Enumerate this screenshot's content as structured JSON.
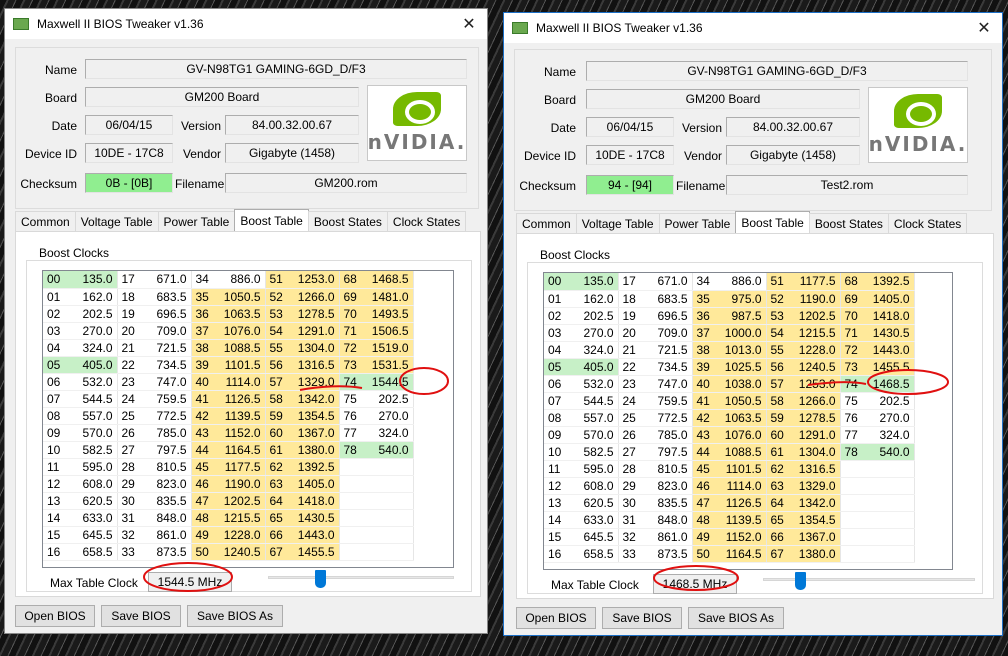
{
  "windows": [
    {
      "title": "Maxwell II BIOS Tweaker v1.36",
      "close_glyph": "✕",
      "info": {
        "name_label": "Name",
        "name_value": "GV-N98TG1 GAMING-6GD_D/F3",
        "board_label": "Board",
        "board_value": "GM200 Board",
        "date_label": "Date",
        "date_value": "06/04/15",
        "version_label": "Version",
        "version_value": "84.00.32.00.67",
        "device_label": "Device ID",
        "device_value": "10DE - 17C8",
        "vendor_label": "Vendor",
        "vendor_value": "Gigabyte (1458)",
        "checksum_label": "Checksum",
        "checksum_value": "0B - [0B]",
        "filename_label": "Filename",
        "filename_value": "GM200.rom"
      },
      "logo_text": "nVIDIA.",
      "tabs": [
        "Common",
        "Voltage Table",
        "Power Table",
        "Boost Table",
        "Boost States",
        "Clock States"
      ],
      "active_tab": 3,
      "group_title": "Boost Clocks",
      "rows": [
        [
          "00",
          "135.0",
          "17",
          "671.0",
          "34",
          "886.0",
          "51",
          "1253.0",
          "68",
          "1468.5"
        ],
        [
          "01",
          "162.0",
          "18",
          "683.5",
          "35",
          "1050.5",
          "52",
          "1266.0",
          "69",
          "1481.0"
        ],
        [
          "02",
          "202.5",
          "19",
          "696.5",
          "36",
          "1063.5",
          "53",
          "1278.5",
          "70",
          "1493.5"
        ],
        [
          "03",
          "270.0",
          "20",
          "709.0",
          "37",
          "1076.0",
          "54",
          "1291.0",
          "71",
          "1506.5"
        ],
        [
          "04",
          "324.0",
          "21",
          "721.5",
          "38",
          "1088.5",
          "55",
          "1304.0",
          "72",
          "1519.0"
        ],
        [
          "05",
          "405.0",
          "22",
          "734.5",
          "39",
          "1101.5",
          "56",
          "1316.5",
          "73",
          "1531.5"
        ],
        [
          "06",
          "532.0",
          "23",
          "747.0",
          "40",
          "1114.0",
          "57",
          "1329.0",
          "74",
          "1544.5"
        ],
        [
          "07",
          "544.5",
          "24",
          "759.5",
          "41",
          "1126.5",
          "58",
          "1342.0",
          "75",
          "202.5"
        ],
        [
          "08",
          "557.0",
          "25",
          "772.5",
          "42",
          "1139.5",
          "59",
          "1354.5",
          "76",
          "270.0"
        ],
        [
          "09",
          "570.0",
          "26",
          "785.0",
          "43",
          "1152.0",
          "60",
          "1367.0",
          "77",
          "324.0"
        ],
        [
          "10",
          "582.5",
          "27",
          "797.5",
          "44",
          "1164.5",
          "61",
          "1380.0",
          "78",
          "540.0"
        ],
        [
          "11",
          "595.0",
          "28",
          "810.5",
          "45",
          "1177.5",
          "62",
          "1392.5",
          "",
          ""
        ],
        [
          "12",
          "608.0",
          "29",
          "823.0",
          "46",
          "1190.0",
          "63",
          "1405.0",
          "",
          ""
        ],
        [
          "13",
          "620.5",
          "30",
          "835.5",
          "47",
          "1202.5",
          "64",
          "1418.0",
          "",
          ""
        ],
        [
          "14",
          "633.0",
          "31",
          "848.0",
          "48",
          "1215.5",
          "65",
          "1430.5",
          "",
          ""
        ],
        [
          "15",
          "645.5",
          "32",
          "861.0",
          "49",
          "1228.0",
          "66",
          "1443.0",
          "",
          ""
        ],
        [
          "16",
          "658.5",
          "33",
          "873.5",
          "50",
          "1240.5",
          "67",
          "1455.5",
          "",
          ""
        ]
      ],
      "max_label": "Max Table Clock",
      "max_value": "1544.5 MHz",
      "slider_level": 0.27,
      "buttons": [
        "Open BIOS",
        "Save BIOS",
        "Save BIOS As"
      ]
    },
    {
      "title": "Maxwell II BIOS Tweaker v1.36",
      "close_glyph": "✕",
      "info": {
        "name_label": "Name",
        "name_value": "GV-N98TG1 GAMING-6GD_D/F3",
        "board_label": "Board",
        "board_value": "GM200 Board",
        "date_label": "Date",
        "date_value": "06/04/15",
        "version_label": "Version",
        "version_value": "84.00.32.00.67",
        "device_label": "Device ID",
        "device_value": "10DE - 17C8",
        "vendor_label": "Vendor",
        "vendor_value": "Gigabyte (1458)",
        "checksum_label": "Checksum",
        "checksum_value": "94 - [94]",
        "filename_label": "Filename",
        "filename_value": "Test2.rom"
      },
      "logo_text": "nVIDIA.",
      "tabs": [
        "Common",
        "Voltage Table",
        "Power Table",
        "Boost Table",
        "Boost States",
        "Clock States"
      ],
      "active_tab": 3,
      "group_title": "Boost Clocks",
      "rows": [
        [
          "00",
          "135.0",
          "17",
          "671.0",
          "34",
          "886.0",
          "51",
          "1177.5",
          "68",
          "1392.5"
        ],
        [
          "01",
          "162.0",
          "18",
          "683.5",
          "35",
          "975.0",
          "52",
          "1190.0",
          "69",
          "1405.0"
        ],
        [
          "02",
          "202.5",
          "19",
          "696.5",
          "36",
          "987.5",
          "53",
          "1202.5",
          "70",
          "1418.0"
        ],
        [
          "03",
          "270.0",
          "20",
          "709.0",
          "37",
          "1000.0",
          "54",
          "1215.5",
          "71",
          "1430.5"
        ],
        [
          "04",
          "324.0",
          "21",
          "721.5",
          "38",
          "1013.0",
          "55",
          "1228.0",
          "72",
          "1443.0"
        ],
        [
          "05",
          "405.0",
          "22",
          "734.5",
          "39",
          "1025.5",
          "56",
          "1240.5",
          "73",
          "1455.5"
        ],
        [
          "06",
          "532.0",
          "23",
          "747.0",
          "40",
          "1038.0",
          "57",
          "1253.0",
          "74",
          "1468.5"
        ],
        [
          "07",
          "544.5",
          "24",
          "759.5",
          "41",
          "1050.5",
          "58",
          "1266.0",
          "75",
          "202.5"
        ],
        [
          "08",
          "557.0",
          "25",
          "772.5",
          "42",
          "1063.5",
          "59",
          "1278.5",
          "76",
          "270.0"
        ],
        [
          "09",
          "570.0",
          "26",
          "785.0",
          "43",
          "1076.0",
          "60",
          "1291.0",
          "77",
          "324.0"
        ],
        [
          "10",
          "582.5",
          "27",
          "797.5",
          "44",
          "1088.5",
          "61",
          "1304.0",
          "78",
          "540.0"
        ],
        [
          "11",
          "595.0",
          "28",
          "810.5",
          "45",
          "1101.5",
          "62",
          "1316.5",
          "",
          ""
        ],
        [
          "12",
          "608.0",
          "29",
          "823.0",
          "46",
          "1114.0",
          "63",
          "1329.0",
          "",
          ""
        ],
        [
          "13",
          "620.5",
          "30",
          "835.5",
          "47",
          "1126.5",
          "64",
          "1342.0",
          "",
          ""
        ],
        [
          "14",
          "633.0",
          "31",
          "848.0",
          "48",
          "1139.5",
          "65",
          "1354.5",
          "",
          ""
        ],
        [
          "15",
          "645.5",
          "32",
          "861.0",
          "49",
          "1152.0",
          "66",
          "1367.0",
          "",
          ""
        ],
        [
          "16",
          "658.5",
          "33",
          "873.5",
          "50",
          "1164.5",
          "67",
          "1380.0",
          "",
          ""
        ]
      ],
      "max_label": "Max Table Clock",
      "max_value": "1468.5 MHz",
      "slider_level": 0.16,
      "buttons": [
        "Open BIOS",
        "Save BIOS",
        "Save BIOS As"
      ]
    }
  ],
  "colors": {
    "yellow_cell": "#ffe99a",
    "green_cell": "#c7f0c7",
    "checksum_green": "#90ee90",
    "annotation_red": "#e01010",
    "slider_thumb": "#0078d7"
  }
}
